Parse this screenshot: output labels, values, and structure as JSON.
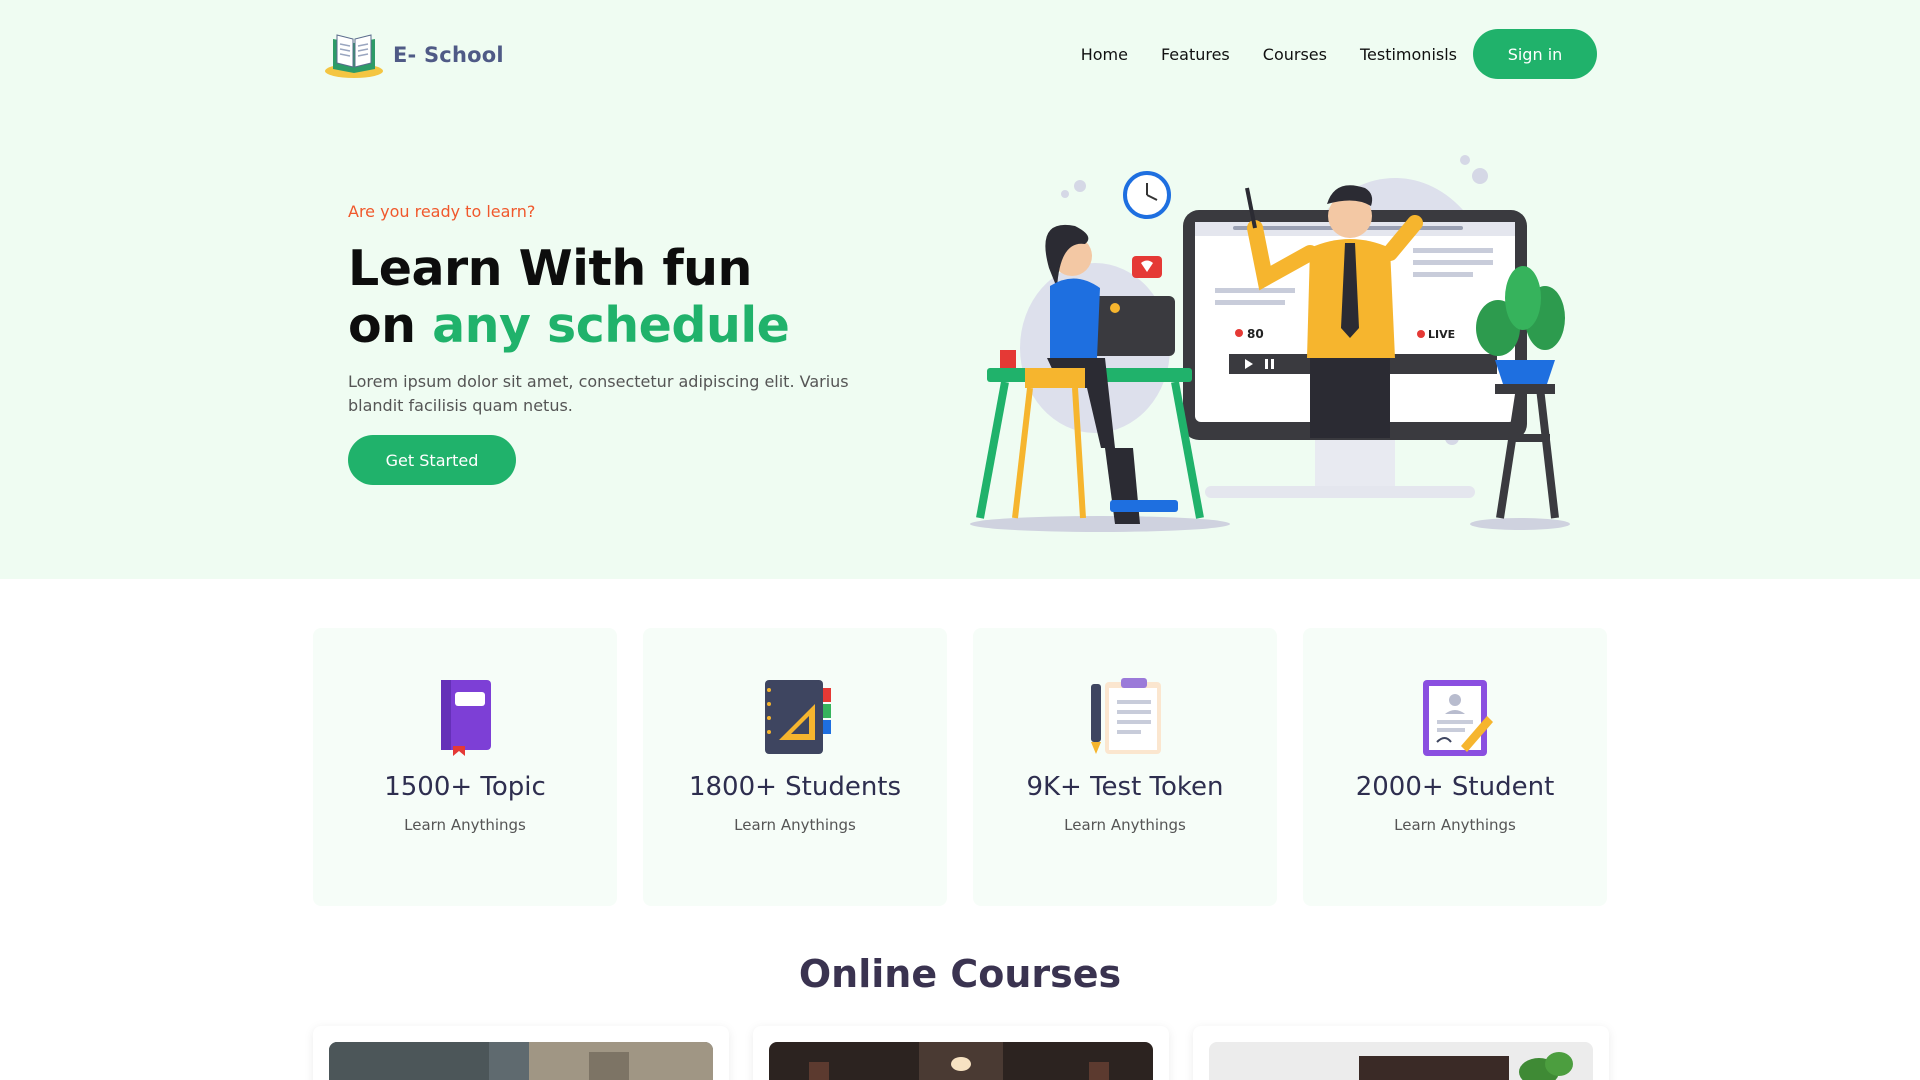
{
  "brand": {
    "name": "E- School",
    "icon": "book-logo-icon"
  },
  "nav": {
    "links": [
      "Home",
      "Features",
      "Courses",
      "Testimonisls"
    ],
    "signin_label": "Sign in"
  },
  "hero": {
    "eyebrow": "Are you ready to learn?",
    "title_line1": "Learn With fun",
    "title_line2_prefix": "on ",
    "title_line2_accent": "any schedule",
    "description": "Lorem ipsum dolor sit amet, consectetur adipiscing elit. Varius blandit facilisis quam netus.",
    "cta_label": "Get Started",
    "illustration": {
      "icon": "online-class-illustration",
      "viewer_count": "80",
      "live_badge": "LIVE"
    }
  },
  "stats": [
    {
      "icon": "purple-book-icon",
      "value": "1500+ Topic",
      "label": "Learn Anythings"
    },
    {
      "icon": "notebook-ruler-icon",
      "value": "1800+ Students",
      "label": "Learn Anythings"
    },
    {
      "icon": "clipboard-pencil-icon",
      "value": "9K+ Test Token",
      "label": "Learn Anythings"
    },
    {
      "icon": "certificate-icon",
      "value": "2000+ Student",
      "label": "Learn Anythings"
    }
  ],
  "courses_section": {
    "title": "Online Courses"
  },
  "courses": [
    {
      "icon": "classroom-photo"
    },
    {
      "icon": "lecture-hall-photo"
    },
    {
      "icon": "laptop-desk-photo"
    }
  ],
  "colors": {
    "accent": "#20b26b",
    "hero_bg": "#effcf2",
    "eyebrow": "#f0582c",
    "brand_text": "#4f5a86",
    "section_title": "#3a3350"
  }
}
